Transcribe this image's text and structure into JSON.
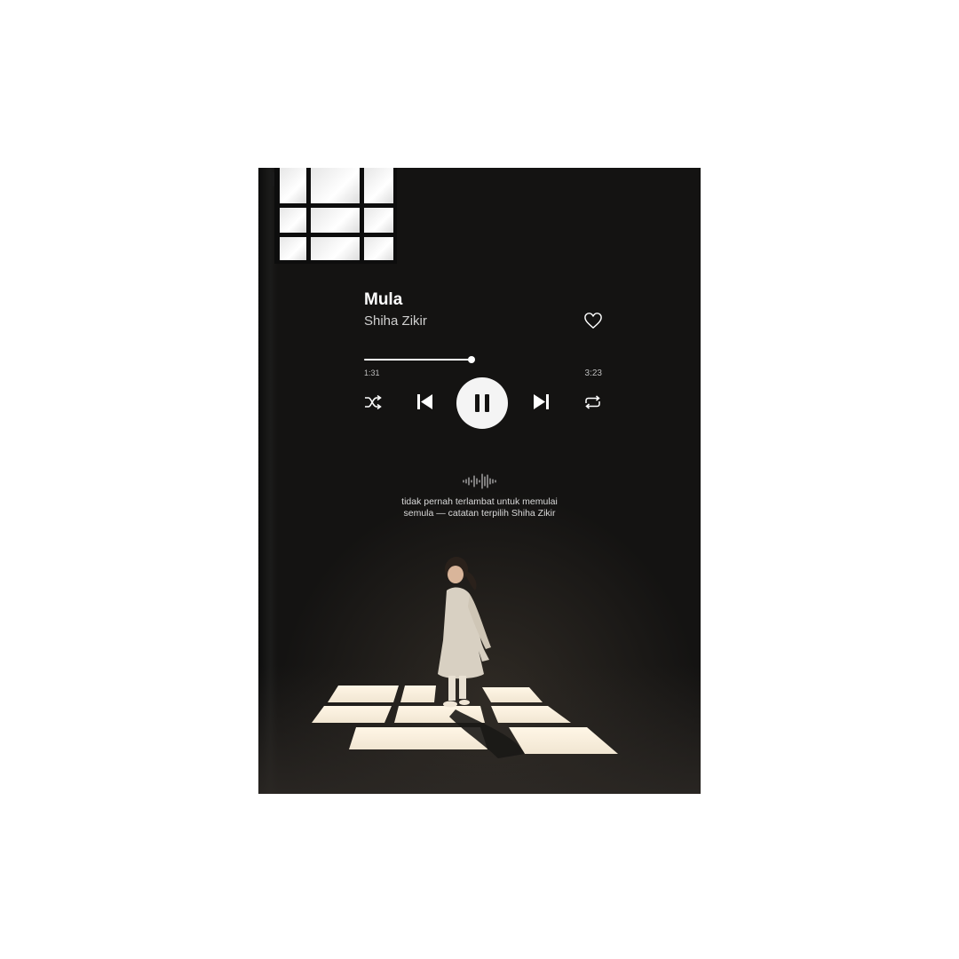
{
  "player": {
    "title": "Mula",
    "artist": "Shiha Zikir",
    "elapsed": "1:31",
    "duration": "3:23",
    "progress": 0.45,
    "state": "playing"
  },
  "controls": {
    "shuffle_icon": "shuffle-icon",
    "previous_icon": "skip-previous-icon",
    "play_pause_icon": "pause-icon",
    "next_icon": "skip-next-icon",
    "repeat_icon": "repeat-icon",
    "like_icon": "heart-icon"
  },
  "caption": {
    "line1": "tidak pernah terlambat untuk memulai",
    "line2": "semula — catatan terpilih Shiha Zikir"
  },
  "colors": {
    "background": "#141312",
    "foreground": "#ffffff",
    "button": "#f4f4f4",
    "muted": "#bdbdbd"
  }
}
